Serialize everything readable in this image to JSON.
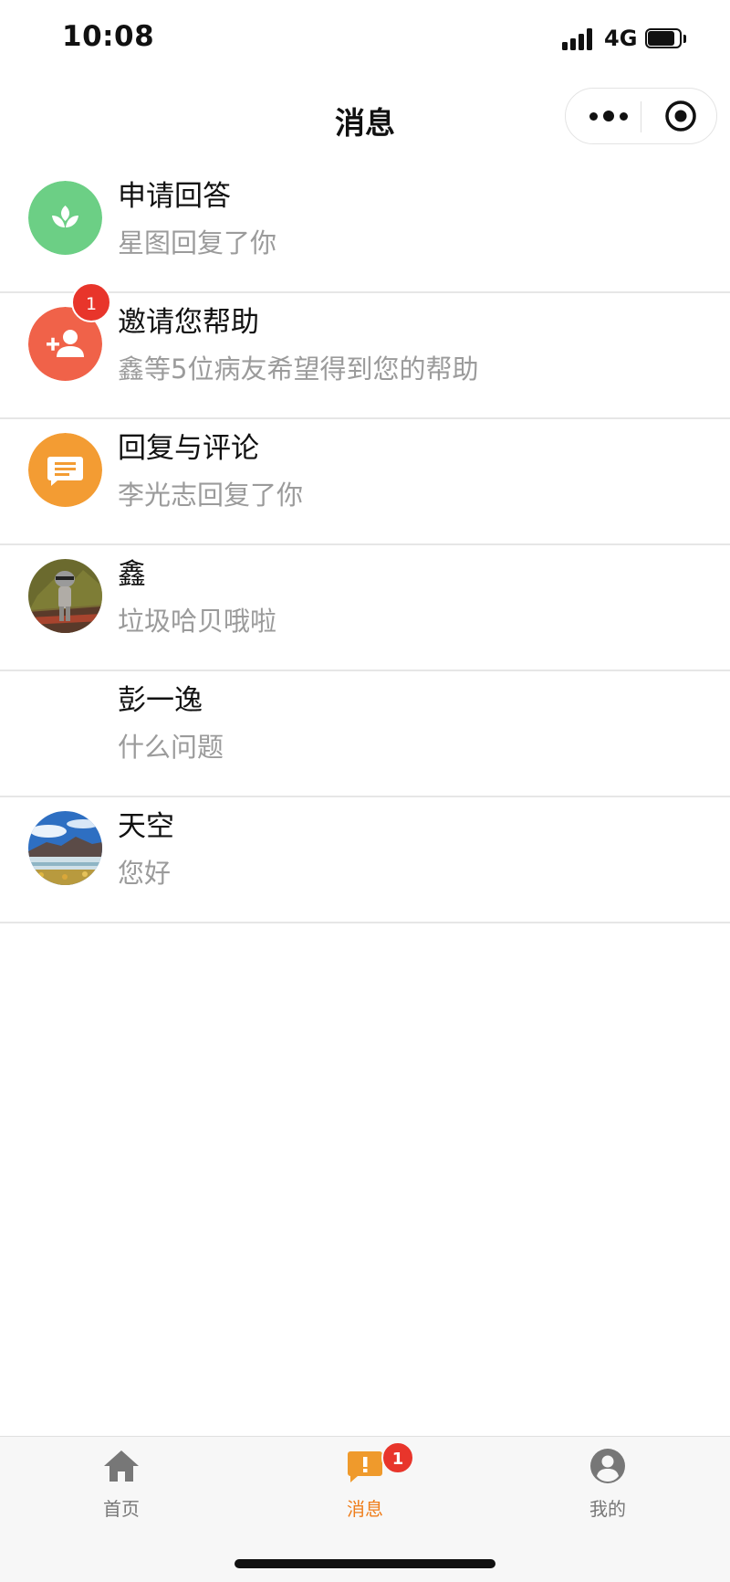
{
  "status_bar": {
    "time": "10:08",
    "network": "4G",
    "battery_level": 0.85
  },
  "nav": {
    "title": "消息"
  },
  "messages": [
    {
      "title": "申请回答",
      "preview": "星图回复了你",
      "icon": "sprout-icon",
      "color": "#6ccf85"
    },
    {
      "title": "邀请您帮助",
      "preview": "鑫等5位病友希望得到您的帮助",
      "icon": "add-user-icon",
      "color": "#f06249",
      "badge": "1"
    },
    {
      "title": "回复与评论",
      "preview": "李光志回复了你",
      "icon": "comment-icon",
      "color": "#f39c33"
    },
    {
      "title": "鑫",
      "preview": "垃圾哈贝哦啦",
      "icon": "user-avatar-photo"
    },
    {
      "title": "彭一逸",
      "preview": "什么问题",
      "icon": "blank-avatar"
    },
    {
      "title": "天空",
      "preview": "您好",
      "icon": "landscape-avatar-photo"
    }
  ],
  "tabbar": {
    "items": [
      {
        "label": "首页",
        "icon": "home-icon"
      },
      {
        "label": "消息",
        "icon": "message-alert-icon",
        "badge": "1",
        "active": true
      },
      {
        "label": "我的",
        "icon": "profile-icon"
      }
    ],
    "active_color": "#ef7d1a",
    "inactive_color": "#777777"
  }
}
